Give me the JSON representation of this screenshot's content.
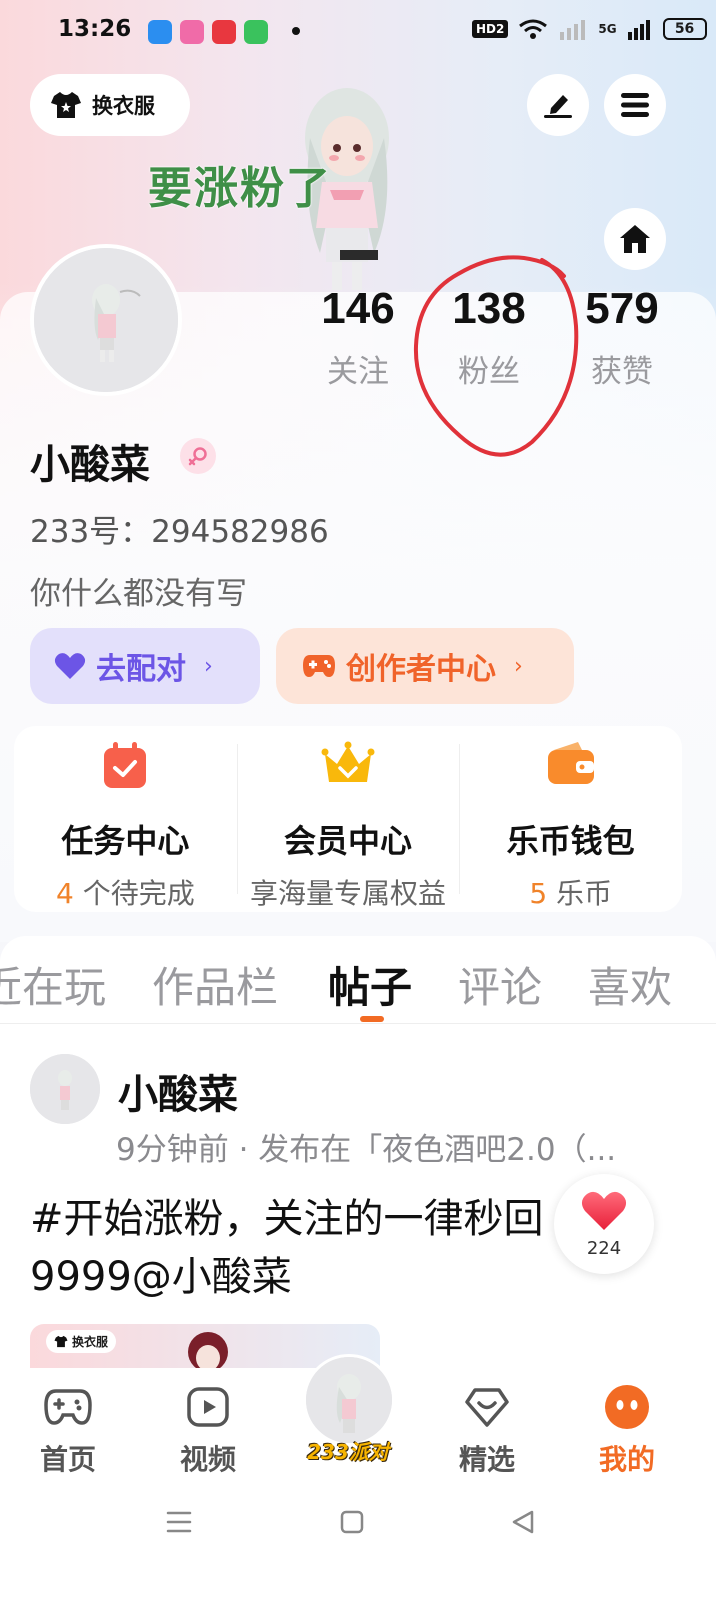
{
  "status_bar": {
    "time": "13:26",
    "hd": "HD2",
    "network": "5G",
    "battery": "56"
  },
  "top": {
    "outfit_label": "换衣服",
    "overlay_text": "要涨粉了"
  },
  "stats": {
    "following": {
      "value": "146",
      "label": "关注"
    },
    "fans": {
      "value": "138",
      "label": "粉丝"
    },
    "likes": {
      "value": "579",
      "label": "获赞"
    }
  },
  "profile": {
    "name": "小酸菜",
    "id_text": "233号：294582986",
    "bio": "你什么都没有写"
  },
  "actions": {
    "match_label": "去配对",
    "creator_label": "创作者中心"
  },
  "services": [
    {
      "title": "任务中心",
      "highlight": "4",
      "sub": " 个待完成"
    },
    {
      "title": "会员中心",
      "highlight": "",
      "sub": "享海量专属权益"
    },
    {
      "title": "乐币钱包",
      "highlight": "5",
      "sub": " 乐币"
    }
  ],
  "tabs": [
    "近在玩",
    "作品栏",
    "帖子",
    "评论",
    "喜欢"
  ],
  "active_tab": "帖子",
  "post": {
    "author": "小酸菜",
    "meta": "9分钟前 · 发布在「夜色酒吧2.0（...",
    "text": "#开始涨粉，关注的一律秒回9999@小酸菜",
    "like_count": "224",
    "thumb_chip": "换衣服"
  },
  "bottom_nav": {
    "home": "首页",
    "video": "视频",
    "center": "233派对",
    "featured": "精选",
    "mine": "我的"
  },
  "colors": {
    "accent": "#f26b24",
    "match": "#6c55e6",
    "overlay_green": "#3f8f47",
    "annotation_red": "#e0323a"
  }
}
